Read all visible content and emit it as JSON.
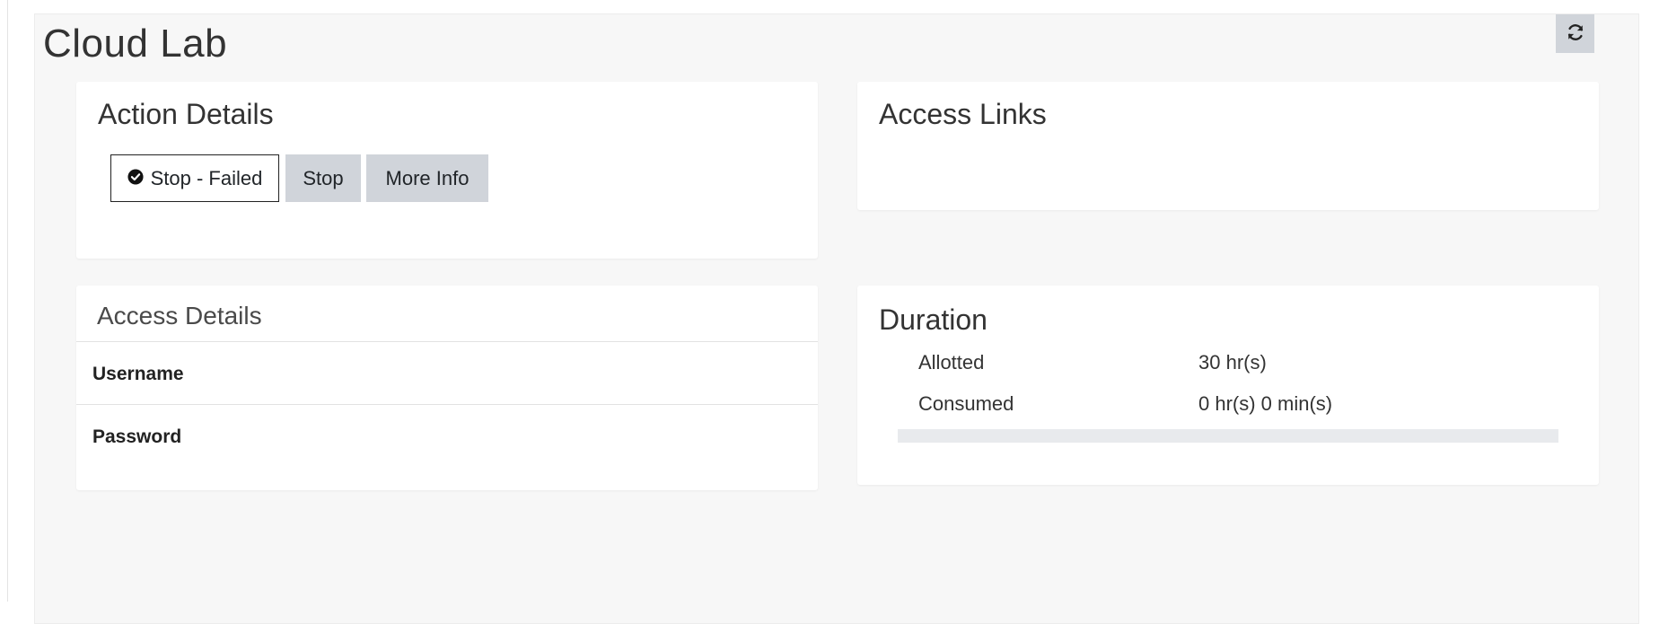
{
  "page": {
    "title": "Cloud Lab"
  },
  "toolbar": {
    "refresh_icon": "refresh-icon"
  },
  "action_details": {
    "title": "Action Details",
    "status_button": {
      "label": "Stop - Failed",
      "icon": "check-circle-icon"
    },
    "stop_label": "Stop",
    "more_info_label": "More Info"
  },
  "access_links": {
    "title": "Access Links"
  },
  "access_details": {
    "title": "Access Details",
    "username_label": "Username",
    "password_label": "Password"
  },
  "duration": {
    "title": "Duration",
    "allotted_label": "Allotted",
    "allotted_value": "30 hr(s)",
    "consumed_label": "Consumed",
    "consumed_value": "0 hr(s) 0 min(s)",
    "progress_fraction": 0
  },
  "colors": {
    "button_gray": "#d0d4da",
    "panel_bg": "#f7f7f7",
    "progress_track": "#e8eaed"
  }
}
